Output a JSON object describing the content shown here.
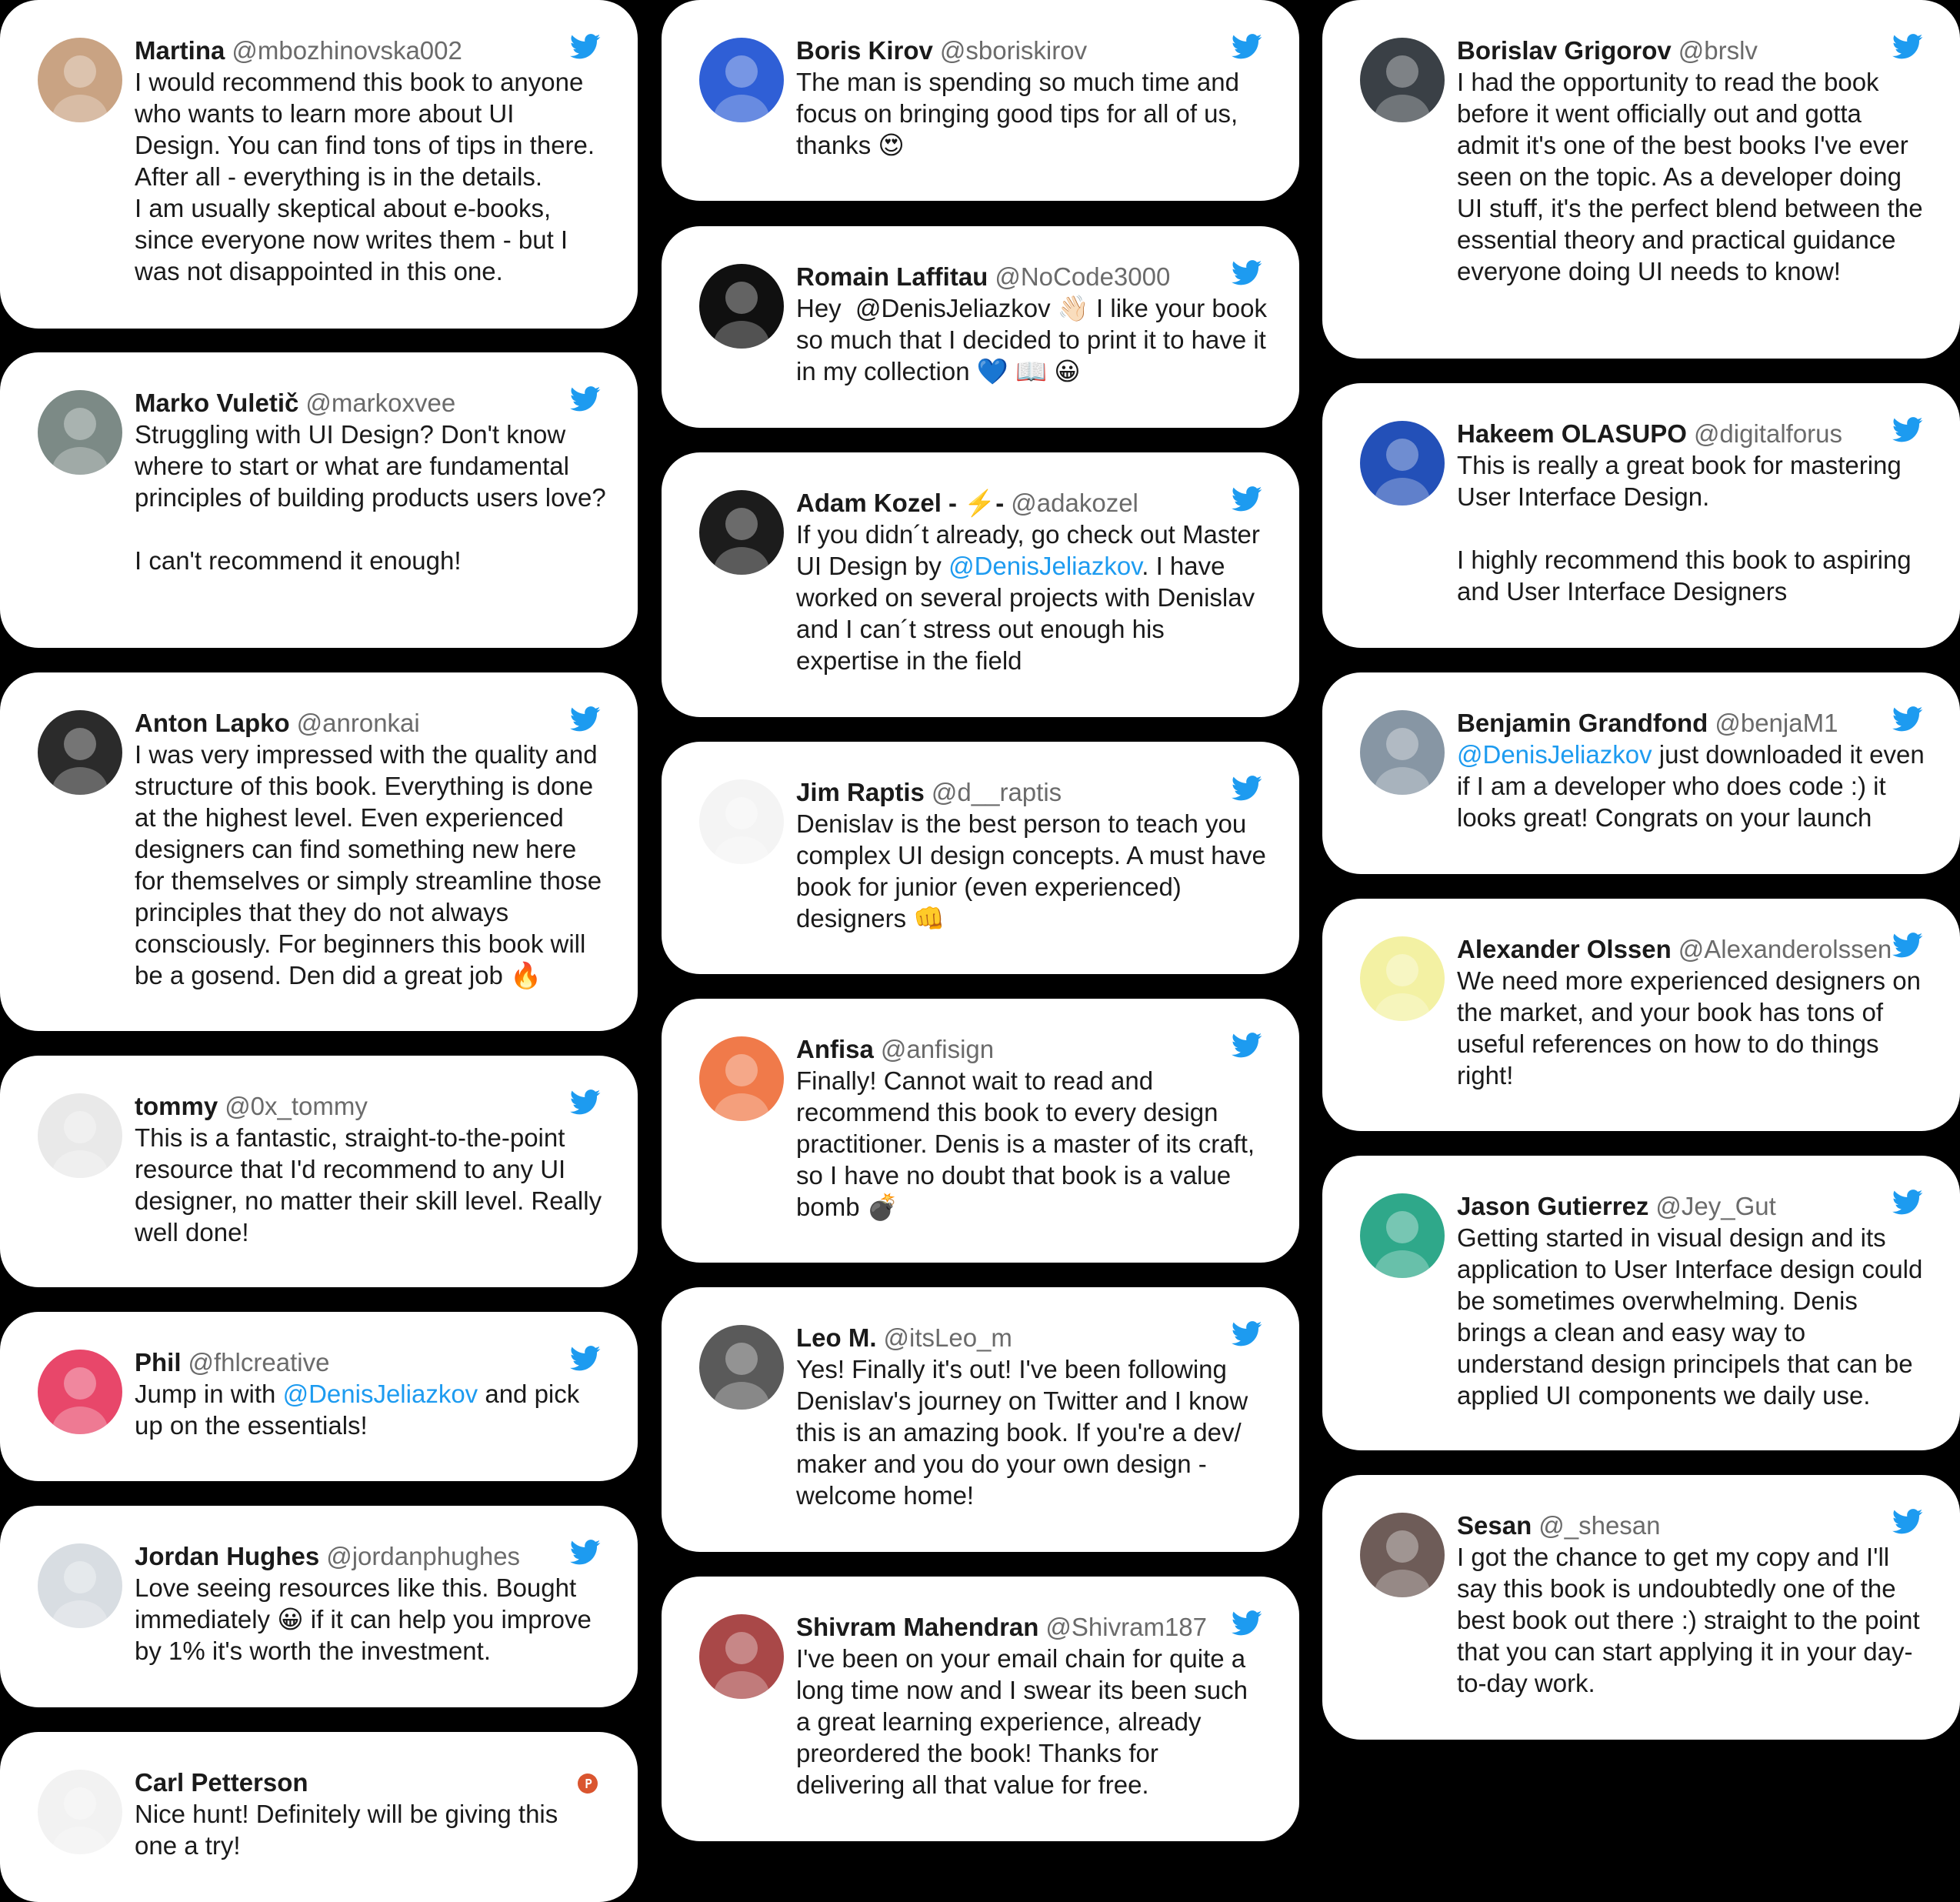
{
  "accent_color": "#1d9bf0",
  "columns": [
    {
      "cards": [
        {
          "name": "Martina",
          "handle": "@mbozhinovska002",
          "source_icon": "twitter-bird-icon",
          "avatar_color": "#c9a383",
          "parts": [
            {
              "t": "I would recommend this book to anyone who wants to learn more about UI Design. You can find tons of tips in there. After all - everything is in the details.\nI am usually skeptical about e-books, since everyone now writes them - but I was not disappointed in this one."
            }
          ]
        },
        {
          "name": "Marko Vuletič",
          "handle": "@markoxvee",
          "source_icon": "twitter-bird-icon",
          "avatar_color": "#7c8a86",
          "parts": [
            {
              "t": "Struggling with UI Design? Don't know where to start or what are fundamental principles of building products users love?\n\nI can't recommend it enough!"
            }
          ]
        },
        {
          "name": "Anton Lapko",
          "handle": "@anronkai",
          "source_icon": "twitter-bird-icon",
          "avatar_color": "#2b2b2b",
          "parts": [
            {
              "t": "I was very impressed with the quality and structure of this book. Everything is done at the highest level. Even experienced designers can find something new here for themselves or simply streamline those principles that they do not always consciously. For beginners this book will be a gosend. Den did a great job 🔥"
            }
          ]
        },
        {
          "name": "tommy",
          "handle": "@0x_tommy",
          "source_icon": "twitter-bird-icon",
          "avatar_color": "#e9e9e9",
          "parts": [
            {
              "t": "This is a fantastic, straight-to-the-point resource that I'd recommend to any UI designer, no matter their skill level. Really well done!"
            }
          ]
        },
        {
          "name": "Phil",
          "handle": "@fhlcreative",
          "source_icon": "twitter-bird-icon",
          "avatar_color": "#e8476a",
          "parts": [
            {
              "t": "Jump in with "
            },
            {
              "t": "@DenisJeliazkov",
              "m": true
            },
            {
              "t": " and pick up on the essentials!"
            }
          ]
        },
        {
          "name": "Jordan Hughes",
          "handle": "@jordanphughes",
          "source_icon": "twitter-bird-icon",
          "avatar_color": "#d8dde2",
          "parts": [
            {
              "t": "Love seeing resources like this. Bought immediately 😀 if it can help you improve by 1% it's worth the investment."
            }
          ]
        },
        {
          "name": "Carl Petterson",
          "handle": "",
          "source_icon": "producthunt-icon",
          "avatar_color": "#f2f2f2",
          "parts": [
            {
              "t": "Nice hunt! Definitely will be giving this one a try!"
            }
          ]
        }
      ]
    },
    {
      "cards": [
        {
          "name": "Boris Kirov",
          "handle": "@sboriskirov",
          "source_icon": "twitter-bird-icon",
          "avatar_color": "#2f5fd6",
          "parts": [
            {
              "t": "The man is spending so much time and focus on bringing good tips for all of us, thanks 😍"
            }
          ]
        },
        {
          "name": "Romain Laffitau",
          "handle": "@NoCode3000",
          "source_icon": "twitter-bird-icon",
          "avatar_color": "#101010",
          "parts": [
            {
              "t": "Hey  @DenisJeliazkov 👋🏻 I like your book so much that I decided to print it to have it in my collection 💙 📖 😀"
            }
          ]
        },
        {
          "name": "Adam Kozel - ⚡️-",
          "handle": "@adakozel",
          "source_icon": "twitter-bird-icon",
          "avatar_color": "#1c1c1c",
          "parts": [
            {
              "t": "If you didn´t already, go check out Master UI Design by "
            },
            {
              "t": "@DenisJeliazkov",
              "m": true
            },
            {
              "t": ". I have worked on several projects with Denislav and I can´t stress out enough his expertise in the field"
            }
          ]
        },
        {
          "name": "Jim Raptis",
          "handle": "@d__raptis",
          "source_icon": "twitter-bird-icon",
          "avatar_color": "#f4f4f4",
          "parts": [
            {
              "t": "Denislav is the best person to teach you complex UI design concepts. A must have book for junior (even experienced) designers 👊"
            }
          ]
        },
        {
          "name": "Anfisa",
          "handle": "@anfisign",
          "source_icon": "twitter-bird-icon",
          "avatar_color": "#f07a4a",
          "parts": [
            {
              "t": "Finally! Cannot wait to read and recommend this book to every design practitioner. Denis is a master of its craft, so I have no doubt that book is a value bomb 💣"
            }
          ]
        },
        {
          "name": "Leo M.",
          "handle": "@itsLeo_m",
          "source_icon": "twitter-bird-icon",
          "avatar_color": "#5a5a5a",
          "parts": [
            {
              "t": "Yes! Finally it's out! I've been following Denislav's journey on Twitter and I know this is an amazing book. If you're a dev/ maker and you do your own design - welcome home!"
            }
          ]
        },
        {
          "name": "Shivram Mahendran",
          "handle": "@Shivram187",
          "source_icon": "twitter-bird-icon",
          "avatar_color": "#a94848",
          "parts": [
            {
              "t": "I've been on your email chain for quite a long time now and I swear its been such a great learning experience, already preordered the book! Thanks for delivering all that value for free."
            }
          ]
        }
      ]
    },
    {
      "cards": [
        {
          "name": "Borislav Grigorov",
          "handle": "@brslv",
          "source_icon": "twitter-bird-icon",
          "avatar_color": "#3a4046",
          "parts": [
            {
              "t": "I had the opportunity to read the book before it went officially out and gotta admit it's one of the best books I've ever seen on the topic. As a developer doing UI stuff, it's the perfect blend between the essential theory and practical guidance everyone doing UI needs to know!"
            }
          ]
        },
        {
          "name": "Hakeem OLASUPO",
          "handle": "@digitalforus",
          "source_icon": "twitter-bird-icon",
          "avatar_color": "#2350b8",
          "parts": [
            {
              "t": "This is really a great book for mastering User Interface Design.\n\nI highly recommend this book to aspiring and User Interface Designers"
            }
          ]
        },
        {
          "name": "Benjamin Grandfond",
          "handle": "@benjaM1",
          "source_icon": "twitter-bird-icon",
          "avatar_color": "#8796a4",
          "parts": [
            {
              "t": "@DenisJeliazkov",
              "m": true
            },
            {
              "t": " just downloaded it even if I am a developer who does code :) it looks great! Congrats on your launch"
            }
          ]
        },
        {
          "name": "Alexander Olssen",
          "handle": "@Alexanderolssen",
          "source_icon": "twitter-bird-icon",
          "avatar_color": "#f3f1a3",
          "parts": [
            {
              "t": "We need more experienced designers on the market, and your book has tons of useful references on how to do things right!"
            }
          ]
        },
        {
          "name": "Jason Gutierrez",
          "handle": "@Jey_Gut",
          "source_icon": "twitter-bird-icon",
          "avatar_color": "#2fa88a",
          "parts": [
            {
              "t": "Getting started in visual design and its application to User Interface design could be sometimes overwhelming. Denis brings a clean and easy way to understand design principels that can be applied UI components we daily use."
            }
          ]
        },
        {
          "name": "Sesan",
          "handle": "@_shesan",
          "source_icon": "twitter-bird-icon",
          "avatar_color": "#6e5c58",
          "parts": [
            {
              "t": "I got the chance to get my copy and I'll say this book is undoubtedly one of the best book out there :) straight to the point that you can start applying it in your day-to-day work."
            }
          ]
        }
      ]
    }
  ]
}
